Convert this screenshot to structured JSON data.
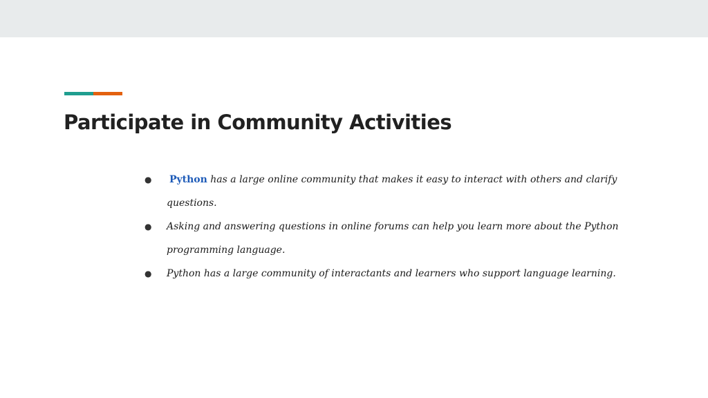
{
  "slide": {
    "title": "Participate in Community Activities",
    "accent_colors": {
      "teal": "#1f9e8f",
      "orange": "#e3610f"
    },
    "link_color": "#1e5bb8",
    "top_bar_color": "#e8ebec",
    "bullets": [
      {
        "link": "Python",
        "text": " has a large online community that makes it easy to interact with others and clarify questions."
      },
      {
        "text": "Asking and answering questions in online forums can help you learn more about the Python programming language."
      },
      {
        "text": "Python has a large community of interactants and learners who support language learning."
      }
    ],
    "bullet_glyph": "●"
  }
}
